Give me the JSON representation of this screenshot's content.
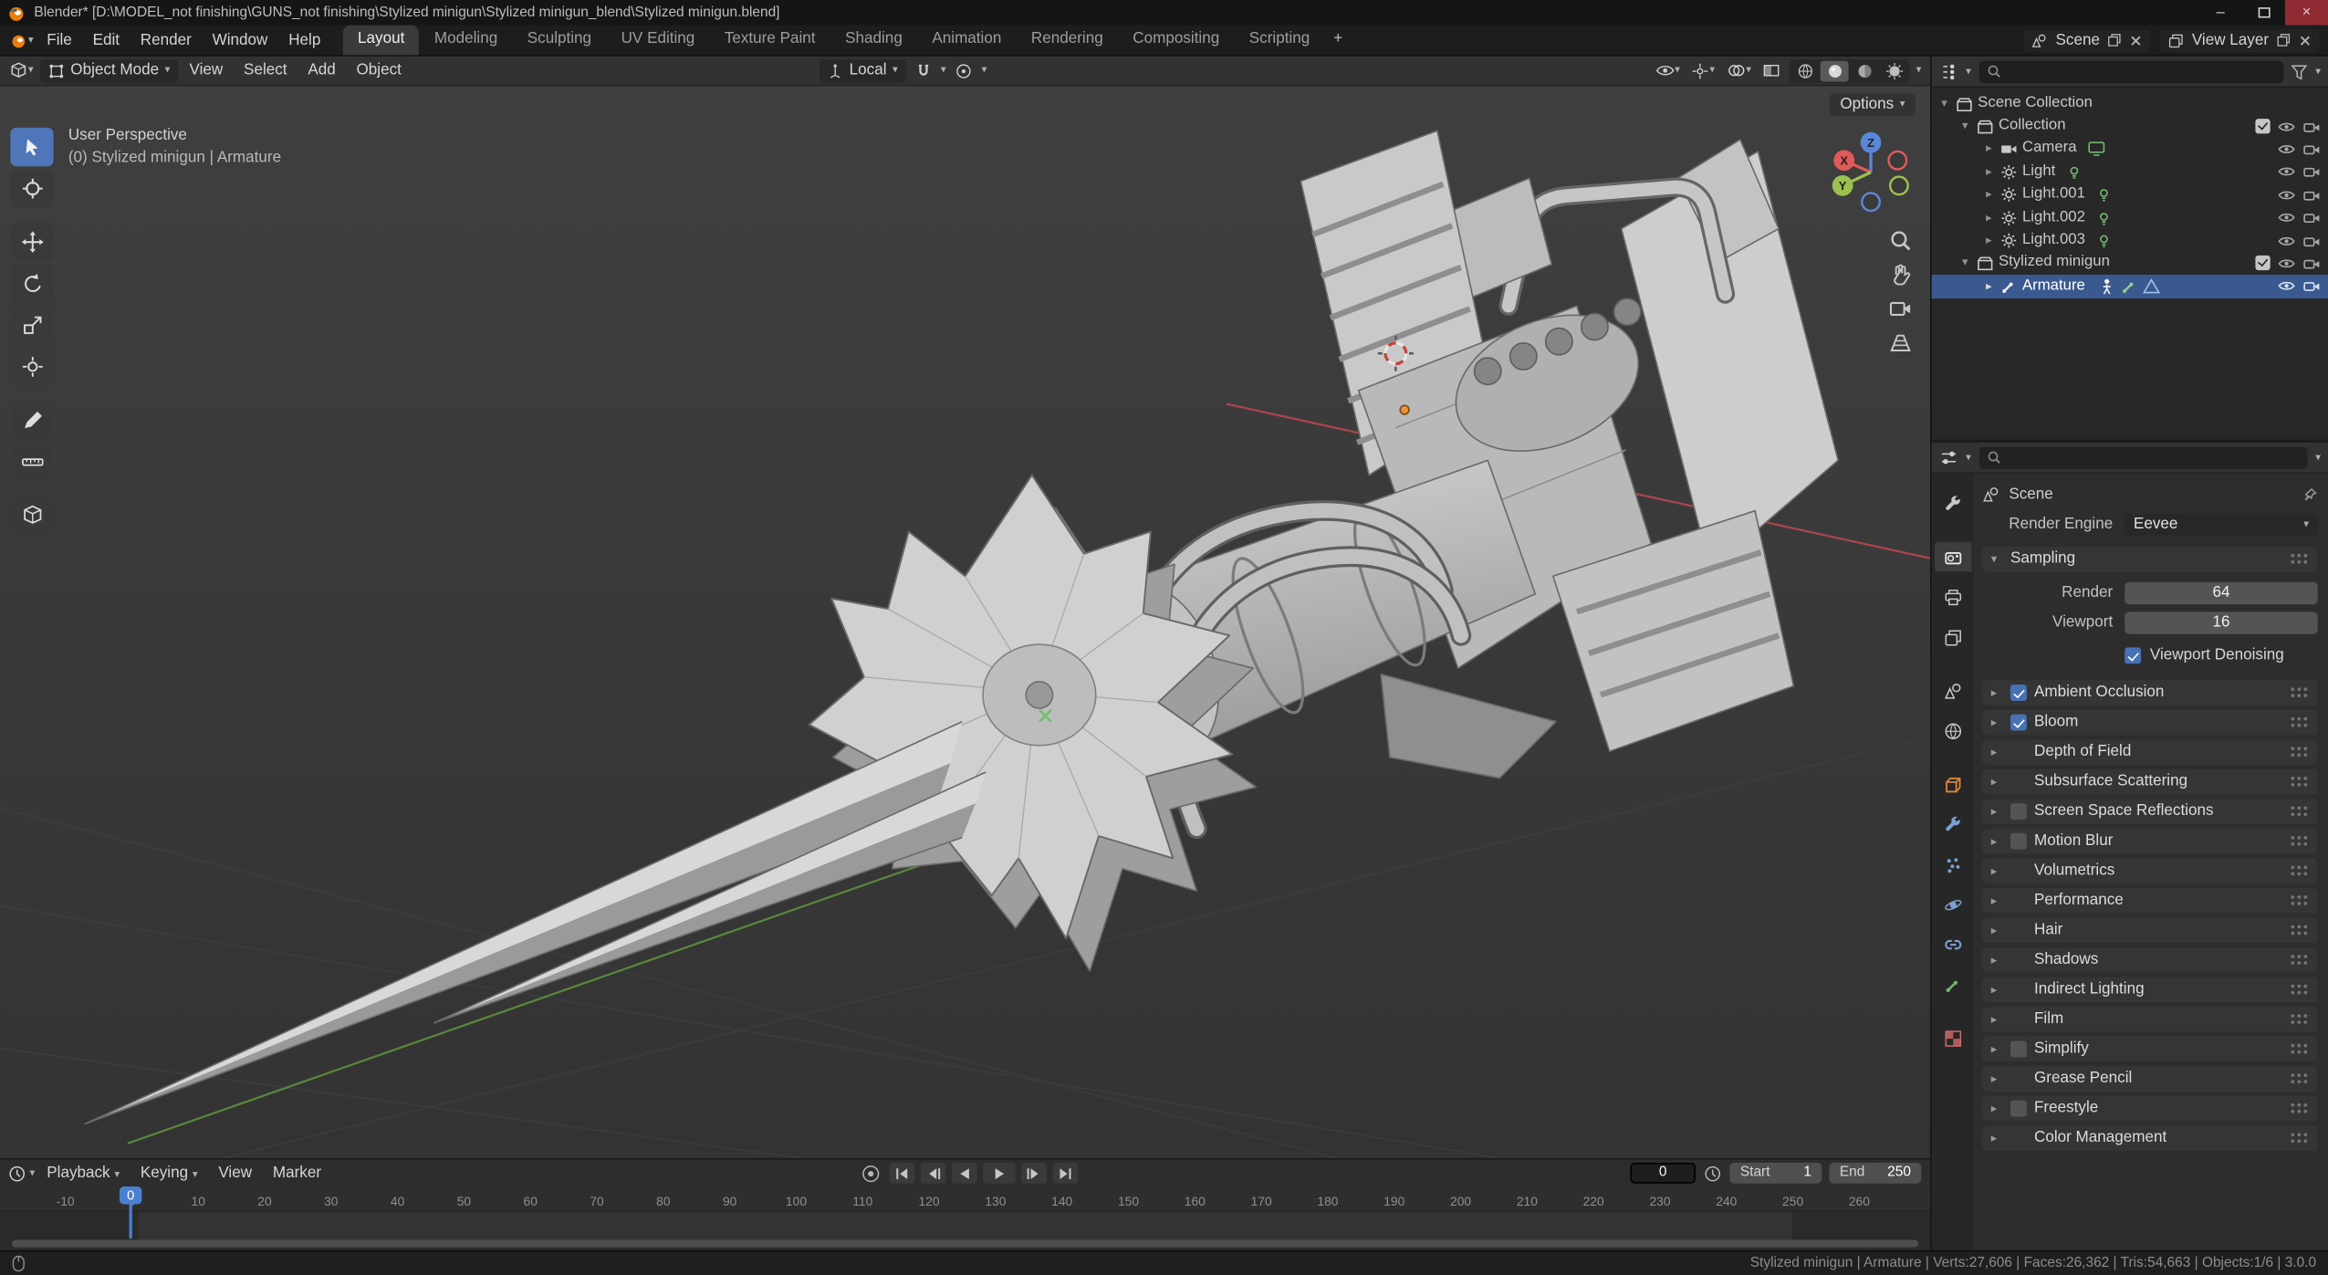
{
  "colors": {
    "accent": "#4772b3",
    "axis_x": "#e05a5a",
    "axis_y": "#9cc04d",
    "axis_z": "#5a86d6",
    "selected_row": "#3a5a8f"
  },
  "titlebar": {
    "title": "Blender* [D:\\MODEL_not finishing\\GUNS_not finishing\\Stylized minigun\\Stylized minigun_blend\\Stylized minigun.blend]",
    "minimize": "–",
    "close": "×"
  },
  "topbar": {
    "menus": [
      "File",
      "Edit",
      "Render",
      "Window",
      "Help"
    ],
    "tabs": [
      "Layout",
      "Modeling",
      "Sculpting",
      "UV Editing",
      "Texture Paint",
      "Shading",
      "Animation",
      "Rendering",
      "Compositing",
      "Scripting"
    ],
    "active_tab": "Layout",
    "new_tab": "+",
    "scene_label": "Scene",
    "view_layer_label": "View Layer"
  },
  "viewport": {
    "header": {
      "mode": "Object Mode",
      "menus": [
        "View",
        "Select",
        "Add",
        "Object"
      ],
      "orientation": "Local",
      "options_label": "Options"
    },
    "overlay": {
      "title": "User Perspective",
      "subtitle": "(0) Stylized minigun | Armature"
    },
    "gizmo": {
      "x": "X",
      "y": "Y",
      "z": "Z"
    },
    "tools": [
      "tweak-select",
      "cursor",
      "move",
      "rotate",
      "scale",
      "transform",
      "annotate",
      "measure",
      "add-cube"
    ]
  },
  "outliner": {
    "rows": [
      {
        "label": "Scene Collection"
      },
      {
        "label": "Collection"
      },
      {
        "label": "Camera"
      },
      {
        "label": "Light"
      },
      {
        "label": "Light.001"
      },
      {
        "label": "Light.002"
      },
      {
        "label": "Light.003"
      },
      {
        "label": "Stylized minigun"
      },
      {
        "label": "Armature"
      }
    ]
  },
  "properties": {
    "breadcrumb": "Scene",
    "render_engine_label": "Render Engine",
    "render_engine": "Eevee",
    "sampling": {
      "title": "Sampling",
      "render_label": "Render",
      "render_value": "64",
      "viewport_label": "Viewport",
      "viewport_value": "16",
      "denoising_label": "Viewport Denoising",
      "denoising": "checked"
    },
    "panels": [
      {
        "label": "Ambient Occlusion",
        "checkbox": "checked"
      },
      {
        "label": "Bloom",
        "checkbox": "checked"
      },
      {
        "label": "Depth of Field"
      },
      {
        "label": "Subsurface Scattering"
      },
      {
        "label": "Screen Space Reflections",
        "checkbox": "unchecked"
      },
      {
        "label": "Motion Blur",
        "checkbox": "unchecked"
      },
      {
        "label": "Volumetrics"
      },
      {
        "label": "Performance"
      },
      {
        "label": "Hair"
      },
      {
        "label": "Shadows"
      },
      {
        "label": "Indirect Lighting"
      },
      {
        "label": "Film"
      },
      {
        "label": "Simplify",
        "checkbox": "unchecked"
      },
      {
        "label": "Grease Pencil"
      },
      {
        "label": "Freestyle",
        "checkbox": "unchecked"
      },
      {
        "label": "Color Management"
      }
    ]
  },
  "timeline": {
    "menus": [
      "Playback",
      "Keying",
      "View",
      "Marker"
    ],
    "current_frame": "0",
    "start_label": "Start",
    "start_value": "1",
    "end_label": "End",
    "end_value": "250",
    "ruler": [
      "-10",
      "0",
      "10",
      "20",
      "30",
      "40",
      "50",
      "60",
      "70",
      "80",
      "90",
      "100",
      "110",
      "120",
      "130",
      "140",
      "150",
      "160",
      "170",
      "180",
      "190",
      "200",
      "210",
      "220",
      "230",
      "240",
      "250",
      "260"
    ],
    "playhead_label": "0"
  },
  "statusbar": {
    "info": "Stylized minigun | Armature | Verts:27,606 | Faces:26,362 | Tris:54,663 | Objects:1/6 | 3.0.0"
  }
}
